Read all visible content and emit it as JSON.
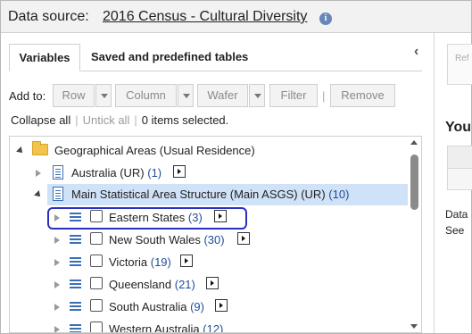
{
  "header": {
    "label": "Data source:",
    "source": "2016 Census - Cultural Diversity",
    "info_icon": "info-icon"
  },
  "tabs": [
    {
      "label": "Variables",
      "active": true
    },
    {
      "label": "Saved and predefined tables",
      "active": false
    }
  ],
  "toolbar": {
    "add_to_label": "Add to:",
    "row_label": "Row",
    "column_label": "Column",
    "wafer_label": "Wafer",
    "filter_label": "Filter",
    "remove_label": "Remove",
    "separator": "|"
  },
  "selection": {
    "collapse_all": "Collapse all",
    "untick_all": "Untick all",
    "separator": "|",
    "status": "0 items selected."
  },
  "tree": {
    "root": {
      "label": "Geographical Areas (Usual Residence)"
    },
    "items": [
      {
        "label": "Australia (UR)",
        "count": "(1)"
      },
      {
        "label": "Main Statistical Area Structure (Main ASGS) (UR)",
        "count": "(10)"
      }
    ],
    "children": [
      {
        "label": "Eastern States",
        "count": "(3)"
      },
      {
        "label": "New South Wales",
        "count": "(30)"
      },
      {
        "label": "Victoria",
        "count": "(19)"
      },
      {
        "label": "Queensland",
        "count": "(21)"
      },
      {
        "label": "South Australia",
        "count": "(9)"
      },
      {
        "label": "Western Australia",
        "count": "(12)"
      }
    ]
  },
  "right_panel": {
    "ref_text": "Ref",
    "heading": "You",
    "line1": "Data",
    "line2": "See"
  },
  "colors": {
    "accent_focus": "#2b2fc1",
    "highlight": "#cfe2f7",
    "count_link": "#1f4e99"
  }
}
